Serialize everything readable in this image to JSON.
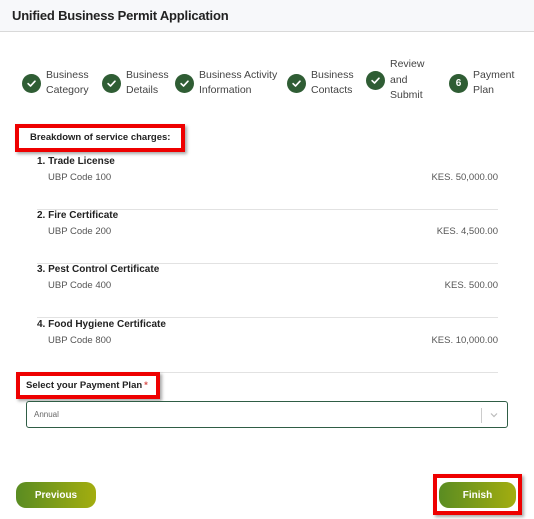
{
  "header": {
    "title": "Unified Business Permit Application"
  },
  "stepper": {
    "steps": [
      {
        "label_line1": "Business",
        "label_line2": "Category",
        "status": "complete",
        "icon": "check-icon"
      },
      {
        "label_line1": "Business",
        "label_line2": "Details",
        "status": "complete",
        "icon": "check-icon"
      },
      {
        "label_line1": "Business Activity",
        "label_line2": "Information",
        "status": "complete",
        "icon": "check-icon"
      },
      {
        "label_line1": "Business",
        "label_line2": "Contacts",
        "status": "complete",
        "icon": "check-icon"
      },
      {
        "label_line1": "Review",
        "label_line2": "and",
        "label_line3": "Submit",
        "status": "complete",
        "icon": "check-icon"
      },
      {
        "number": "6",
        "label_line1": "Payment",
        "label_line2": "Plan",
        "status": "current"
      }
    ]
  },
  "charges": {
    "title": "Breakdown of service charges:",
    "items": [
      {
        "name": "1. Trade License",
        "code": "UBP Code 100",
        "amount": "KES. 50,000.00"
      },
      {
        "name": "2. Fire Certificate",
        "code": "UBP Code 200",
        "amount": "KES. 4,500.00"
      },
      {
        "name": "3. Pest Control Certificate",
        "code": "UBP Code 400",
        "amount": "KES. 500.00"
      },
      {
        "name": "4. Food Hygiene Certificate",
        "code": "UBP Code 800",
        "amount": "KES. 10,000.00"
      }
    ]
  },
  "payment_plan": {
    "label": "Select your Payment Plan",
    "required_marker": "*",
    "selected": "Annual"
  },
  "actions": {
    "previous_label": "Previous",
    "finish_label": "Finish"
  },
  "colors": {
    "step_complete": "#2f5d34",
    "highlight": "#ee0000",
    "button_gradient_start": "#5a8c22",
    "button_gradient_end": "#a3ad0f"
  }
}
